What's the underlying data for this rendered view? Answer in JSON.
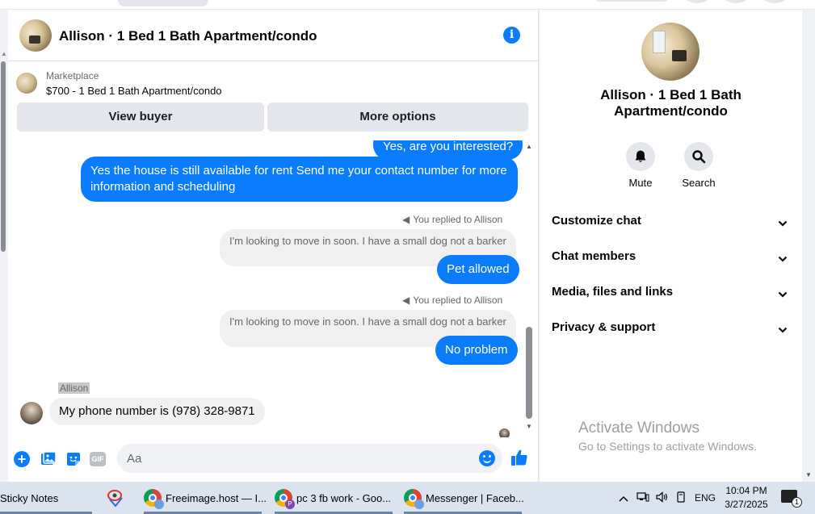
{
  "chat": {
    "title": "Allison · 1 Bed 1 Bath Apartment/condo",
    "marketplace_label": "Marketplace",
    "listing": "$700 - 1 Bed 1 Bath Apartment/condo",
    "view_buyer": "View buyer",
    "more_options": "More options",
    "messages": {
      "partial_top": "Yes, are you interested?",
      "house_available": "Yes the house is still available for rent Send me your contact number for more information and  scheduling",
      "replied_note_1": "You replied to Allison",
      "quoted_1": "I'm looking to move in soon. I have a small dog not a barker",
      "reply_1": "Pet allowed",
      "replied_note_2": "You replied to Allison",
      "quoted_2": "I'm looking to move in soon. I have a small dog not a barker",
      "reply_2": "No problem",
      "sender": "Allison",
      "incoming_phone": "My phone number is (978) 328-9871"
    },
    "composer": {
      "placeholder": "Aa",
      "gif_label": "GIF"
    },
    "accent": "#0a7cff"
  },
  "details": {
    "title": "Allison · 1 Bed 1 Bath Apartment/condo",
    "mute_label": "Mute",
    "search_label": "Search",
    "sections": [
      "Customize chat",
      "Chat members",
      "Media, files and links",
      "Privacy & support"
    ]
  },
  "watermark": {
    "line1": "Activate Windows",
    "line2": "Go to Settings to activate Windows."
  },
  "taskbar": {
    "items": [
      {
        "label": "Sticky Notes"
      },
      {
        "label": "Freeimage.host — I..."
      },
      {
        "label": "pc 3 fb work - Goo..."
      },
      {
        "label": "Messenger | Faceb..."
      }
    ],
    "lang": "ENG",
    "time": "10:04 PM",
    "date": "3/27/2025",
    "notif_count": "1"
  }
}
